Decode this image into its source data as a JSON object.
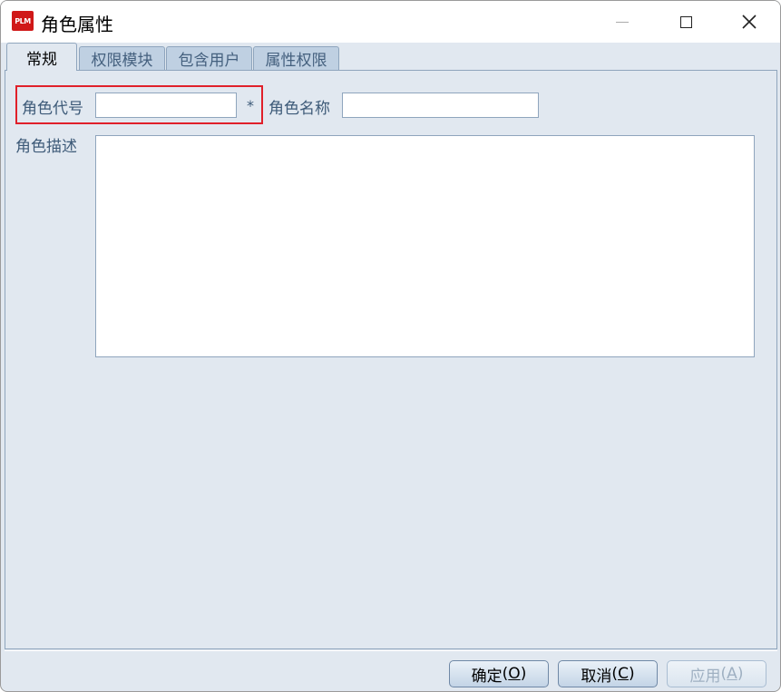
{
  "window": {
    "app_icon_text": "PLM",
    "title": "角色属性"
  },
  "tabs": [
    {
      "label": "常规",
      "active": true
    },
    {
      "label": "权限模块",
      "active": false
    },
    {
      "label": "包含用户",
      "active": false
    },
    {
      "label": "属性权限",
      "active": false
    }
  ],
  "form": {
    "role_code_label": "角色代号",
    "role_code_value": "",
    "required_mark": "*",
    "role_name_label": "角色名称",
    "role_name_value": "",
    "role_desc_label": "角色描述",
    "role_desc_value": ""
  },
  "buttons": {
    "ok": {
      "text": "确定",
      "open": "(",
      "mnemonic": "O",
      "close": ")"
    },
    "cancel": {
      "text": "取消",
      "open": "(",
      "mnemonic": "C",
      "close": ")"
    },
    "apply": {
      "text": "应用",
      "open": "(",
      "mnemonic": "A",
      "close": ")"
    }
  },
  "colors": {
    "highlight_border": "#e0202a",
    "panel_background": "#e1e8f0",
    "tab_inactive": "#bfd0e2"
  }
}
